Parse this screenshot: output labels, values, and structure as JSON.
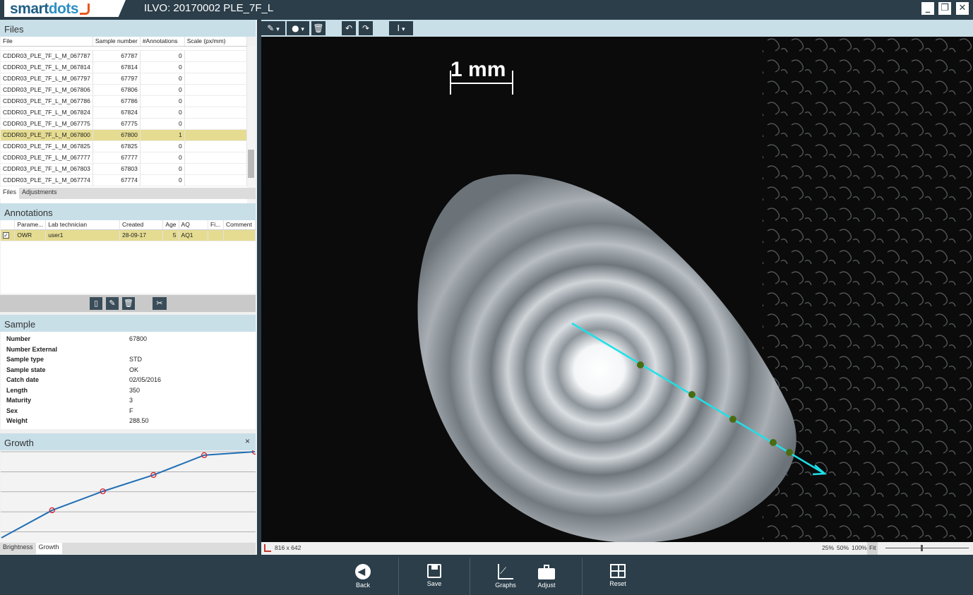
{
  "app": {
    "logo_main": "smart",
    "logo_accent": "dots",
    "title": "ILVO: 20170002 PLE_7F_L"
  },
  "window": {
    "minimize": "_",
    "restore": "❐",
    "close": "✕"
  },
  "files": {
    "header": "Files",
    "columns": [
      "File",
      "Sample number",
      "#Annotations",
      "Scale (px/mm)"
    ],
    "rows": [
      [
        "CDDR03_PLE_7F_L_M_067787",
        "67787",
        "0",
        ""
      ],
      [
        "CDDR03_PLE_7F_L_M_067814",
        "67814",
        "0",
        ""
      ],
      [
        "CDDR03_PLE_7F_L_M_067797",
        "67797",
        "0",
        ""
      ],
      [
        "CDDR03_PLE_7F_L_M_067806",
        "67806",
        "0",
        ""
      ],
      [
        "CDDR03_PLE_7F_L_M_067786",
        "67786",
        "0",
        ""
      ],
      [
        "CDDR03_PLE_7F_L_M_067824",
        "67824",
        "0",
        ""
      ],
      [
        "CDDR03_PLE_7F_L_M_067775",
        "67775",
        "0",
        ""
      ],
      [
        "CDDR03_PLE_7F_L_M_067800",
        "67800",
        "1",
        ""
      ],
      [
        "CDDR03_PLE_7F_L_M_067825",
        "67825",
        "0",
        ""
      ],
      [
        "CDDR03_PLE_7F_L_M_067777",
        "67777",
        "0",
        ""
      ],
      [
        "CDDR03_PLE_7F_L_M_067803",
        "67803",
        "0",
        ""
      ],
      [
        "CDDR03_PLE_7F_L_M_067774",
        "67774",
        "0",
        ""
      ]
    ],
    "selected_index": 7,
    "tabs": [
      "Files",
      "Adjustments"
    ]
  },
  "annotations": {
    "header": "Annotations",
    "columns": [
      "Parame...",
      "Lab technician",
      "Created",
      "Age",
      "AQ",
      "Fi...",
      "Comment"
    ],
    "rows": [
      [
        "OWR",
        "user1",
        "28-09-17",
        "5",
        "AQ1",
        "",
        ""
      ]
    ]
  },
  "sample": {
    "header": "Sample",
    "fields": [
      [
        "Number",
        "67800"
      ],
      [
        "Number External",
        ""
      ],
      [
        "Sample type",
        "STD"
      ],
      [
        "Sample state",
        "OK"
      ],
      [
        "Catch date",
        "02/05/2016"
      ],
      [
        "Length",
        "350"
      ],
      [
        "Maturity",
        "3"
      ],
      [
        "Sex",
        "F"
      ],
      [
        "Weight",
        "288.50"
      ]
    ]
  },
  "growth": {
    "header": "Growth",
    "close": "×",
    "tabs": [
      "Brightness",
      "Growth"
    ]
  },
  "chart_data": {
    "type": "line",
    "points": [
      [
        0,
        0
      ],
      [
        1,
        0.32
      ],
      [
        2,
        0.54
      ],
      [
        3,
        0.73
      ],
      [
        4,
        0.96
      ],
      [
        5,
        1.0
      ]
    ],
    "markers": [
      1,
      2,
      3,
      4,
      5
    ],
    "line_color": "#1f6fb5",
    "marker_color": "#d8202a"
  },
  "viewer": {
    "scale_label": "1 mm",
    "dimensions": "816 x 642",
    "zoom_levels": [
      "25%",
      "50%",
      "100%",
      "Fit"
    ],
    "line_color": "#1fe0e8",
    "dot_color": "#4b6b12"
  },
  "bottom": {
    "back": "Back",
    "save": "Save",
    "graphs": "Graphs",
    "adjust": "Adjust",
    "reset": "Reset"
  }
}
